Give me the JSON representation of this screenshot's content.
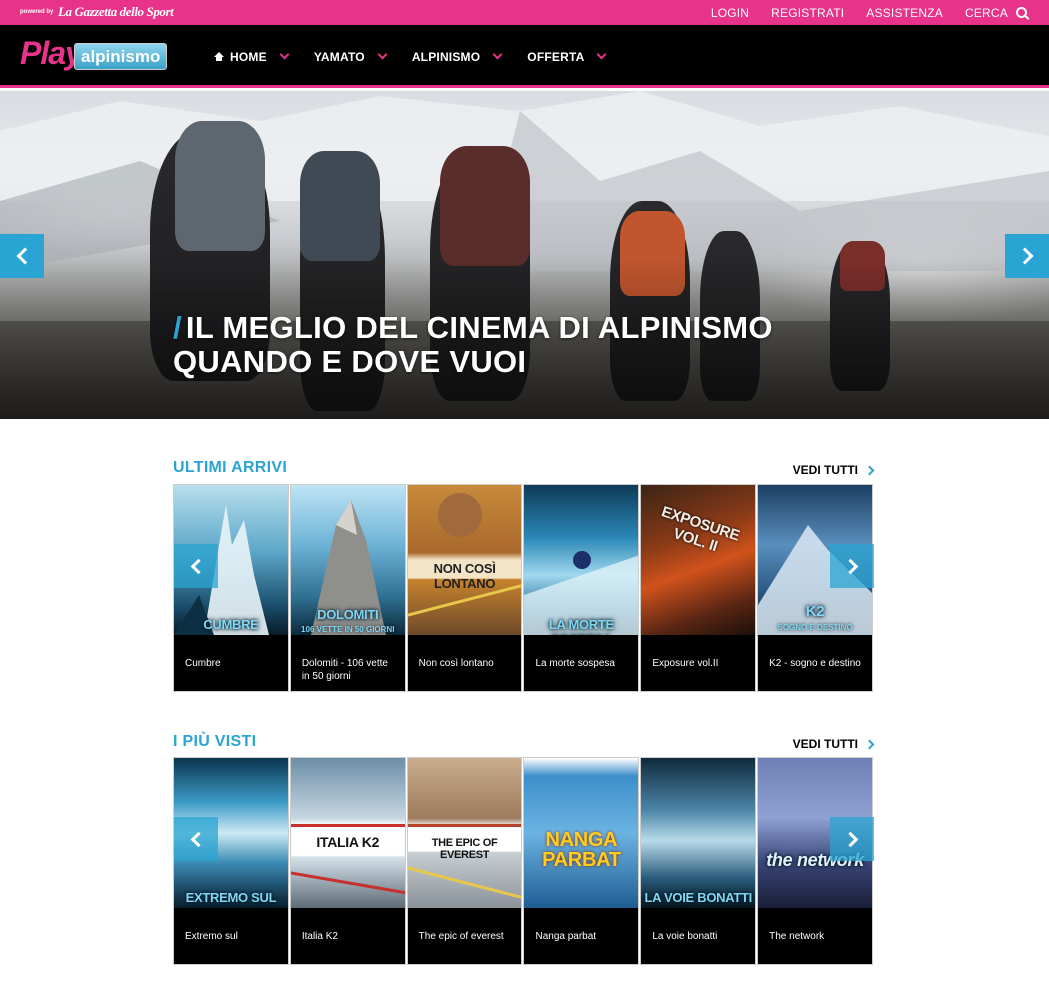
{
  "topbar": {
    "powered_by": "powered by",
    "brand": "La Gazzetta dello Sport",
    "links": [
      "LOGIN",
      "REGISTRATI",
      "ASSISTENZA",
      "CERCA"
    ]
  },
  "header": {
    "logo_main": "Play",
    "logo_sub": "alpinismo",
    "nav": [
      "HOME",
      "YAMATO",
      "ALPINISMO",
      "OFFERTA"
    ]
  },
  "hero": {
    "line1": "IL MEGLIO DEL CINEMA DI ALPINISMO",
    "line2": "QUANDO E DOVE VUOI"
  },
  "sections": [
    {
      "title": "ULTIMI ARRIVI",
      "see_all": "VEDI TUTTI",
      "items": [
        {
          "label": "Cumbre",
          "poster_title": "CUMBRE",
          "poster_sub": ""
        },
        {
          "label": "Dolomiti - 106 vette in 50 giorni",
          "poster_title": "DOLOMITI",
          "poster_sub": "106 VETTE IN 50 GIORNI"
        },
        {
          "label": "Non così lontano",
          "poster_title": "NON COSÌ LONTANO",
          "poster_sub": ""
        },
        {
          "label": "La morte sospesa",
          "poster_title": "LA MORTE SOSPESA",
          "poster_sub": ""
        },
        {
          "label": "Exposure vol.II",
          "poster_title": "EXPOSURE VOL. II",
          "poster_sub": ""
        },
        {
          "label": "K2 - sogno e destino",
          "poster_title": "K2",
          "poster_sub": "SOGNO E DESTINO"
        }
      ]
    },
    {
      "title": "I PIÙ VISTI",
      "see_all": "VEDI TUTTI",
      "items": [
        {
          "label": "Extremo sul",
          "poster_title": "EXTREMO SUL",
          "poster_sub": ""
        },
        {
          "label": "Italia K2",
          "poster_title": "ITALIA K2",
          "poster_sub": ""
        },
        {
          "label": "The epic of everest",
          "poster_title": "THE EPIC OF EVEREST",
          "poster_sub": ""
        },
        {
          "label": "Nanga parbat",
          "poster_title": "NANGA PARBAT",
          "poster_sub": ""
        },
        {
          "label": "La voie bonatti",
          "poster_title": "LA VOIE BONATTI",
          "poster_sub": ""
        },
        {
          "label": "The network",
          "poster_title": "the network",
          "poster_sub": ""
        }
      ]
    }
  ],
  "colors": {
    "accent_pink": "#e8338a",
    "accent_blue": "#2aa4d2",
    "nav_bg": "#000000"
  }
}
